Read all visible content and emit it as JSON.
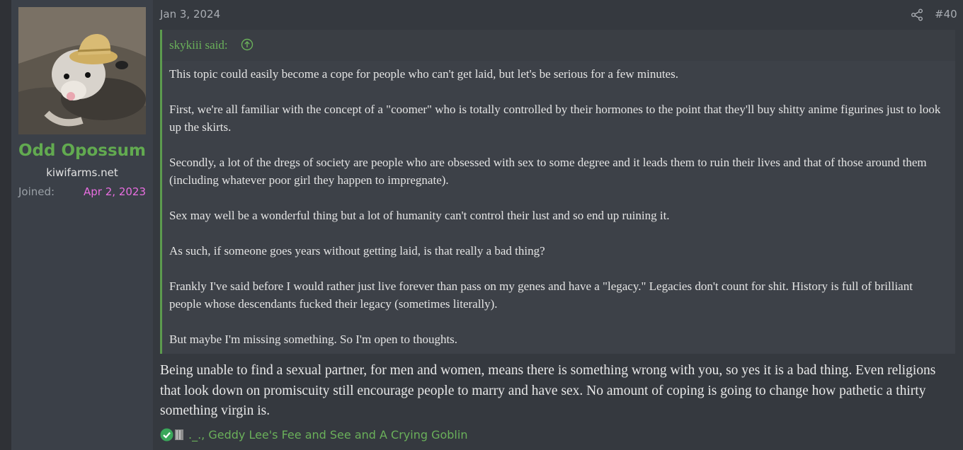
{
  "user": {
    "name": "Odd Opossum",
    "title": "kiwifarms.net",
    "joined_label": "Joined:",
    "joined_value": "Apr 2, 2023"
  },
  "post": {
    "date": "Jan 3, 2024",
    "number": "#40"
  },
  "quote": {
    "author": "skykiii said:",
    "paragraphs": [
      "This topic could easily become a cope for people who can't get laid, but let's be serious for a few minutes.",
      "First, we're all familiar with the concept of a \"coomer\" who is totally controlled by their hormones to the point that they'll buy shitty anime figurines just to look up the skirts.",
      "Secondly, a lot of the dregs of society are people who are obsessed with sex to some degree and it leads them to ruin their lives and that of those around them (including whatever poor girl they happen to impregnate).",
      "Sex may well be a wonderful thing but a lot of humanity can't control their lust and so end up ruining it.",
      "As such, if someone goes years without getting laid, is that really a bad thing?",
      "Frankly I've said before I would rather just live forever than pass on my genes and have a \"legacy.\" Legacies don't count for shit. History is full of brilliant people whose descendants fucked their legacy (sometimes literally).",
      "But maybe I'm missing something. So I'm open to thoughts."
    ]
  },
  "message": "Being unable to find a sexual partner, for men and women, means there is something wrong with you, so yes it is a bad thing. Even religions that look down on promiscuity still encourage people to marry and have sex. No amount of coping is going to change how pathetic a thirty something virgin is.",
  "reactions": {
    "text": "._., Geddy Lee's Fee and See and A Crying Goblin",
    "icons": [
      "check-icon",
      "box-icon"
    ]
  },
  "colors": {
    "username": "#62aa50",
    "joined": "#e86ee0",
    "quote_accent": "#5c9b4e",
    "reaction_link": "#6ab05a"
  }
}
